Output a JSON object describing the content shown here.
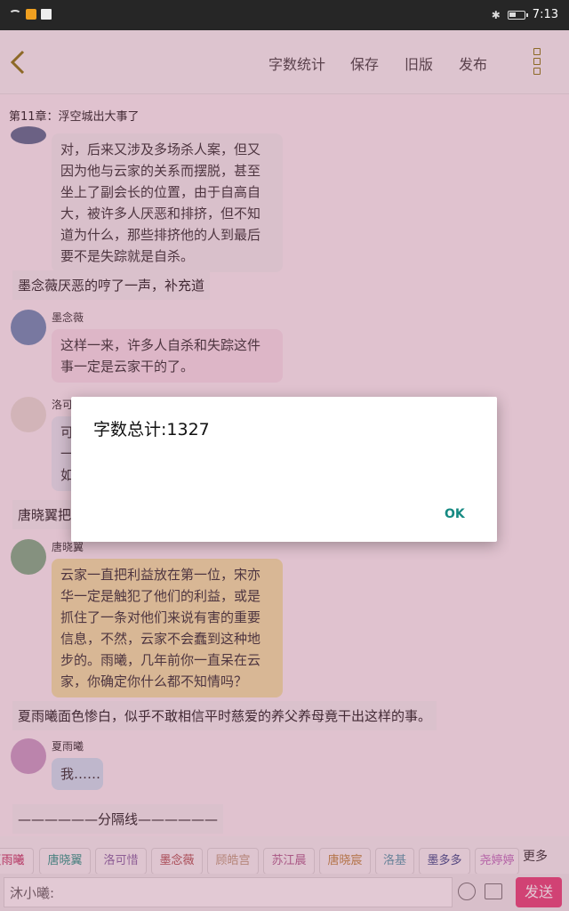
{
  "statusbar": {
    "time": "7:13"
  },
  "toolbar": {
    "buttons": [
      "字数统计",
      "保存",
      "旧版",
      "发布"
    ]
  },
  "chapter_title": "第11章：浮空城出大事了",
  "messages": [
    {
      "type": "bubble-partial",
      "text_lines": [
        "对，后来又涉及多场杀人案，但又",
        "因为他与云家的关系而摆脱，甚至",
        "坐上了副会长的位置，由于自高自",
        "大，被许多人厌恶和排挤，但不知",
        "道为什么，那些排挤他的人到最后",
        "要不是失踪就是自杀。"
      ]
    },
    {
      "type": "narration",
      "text": "墨念薇厌恶的哼了一声，补充道"
    },
    {
      "type": "bubble",
      "name": "墨念薇",
      "text_lines": [
        "这样一来，许多人自杀和失踪这件",
        "事一定是云家干的了。"
      ]
    },
    {
      "type": "bubble",
      "name": "洛可",
      "text_lines": [
        "可",
        "一",
        "如"
      ]
    },
    {
      "type": "narration",
      "text": "唐晓翼把"
    },
    {
      "type": "bubble",
      "name": "唐晓翼",
      "text_lines": [
        "云家一直把利益放在第一位，宋亦",
        "华一定是触犯了他们的利益，或是",
        "抓住了一条对他们来说有害的重要",
        "信息，不然，云家不会蠢到这种地",
        "步的。雨曦，几年前你一直呆在云",
        "家，你确定你什么都不知情吗？"
      ]
    },
    {
      "type": "narration",
      "text": "夏雨曦面色惨白，似乎不敢相信平时慈爱的养父养母竟干出这样的事。"
    },
    {
      "type": "bubble",
      "name": "夏雨曦",
      "text_lines": [
        "我……"
      ]
    },
    {
      "type": "narration",
      "text": "——————分隔线——————"
    }
  ],
  "character_tags": [
    {
      "label": "夏雨曦",
      "color": "#c03060"
    },
    {
      "label": "唐晓翼",
      "color": "#2a9a8a"
    },
    {
      "label": "洛可惜",
      "color": "#8a6aa8"
    },
    {
      "label": "墨念薇",
      "color": "#b05050"
    },
    {
      "label": "顾皓宫",
      "color": "#c0a080"
    },
    {
      "label": "苏江晨",
      "color": "#b06090"
    },
    {
      "label": "唐晓宸",
      "color": "#c08a40"
    },
    {
      "label": "洛基",
      "color": "#5aa0b0"
    },
    {
      "label": "墨多多",
      "color": "#3a4a8a"
    },
    {
      "label": "尧婷婷",
      "color": "#c070c0"
    }
  ],
  "tags_more": "更多",
  "input": {
    "value": "沐小曦:"
  },
  "send_label": "发送",
  "dialog": {
    "message": "字数总计:1327",
    "ok": "OK"
  }
}
